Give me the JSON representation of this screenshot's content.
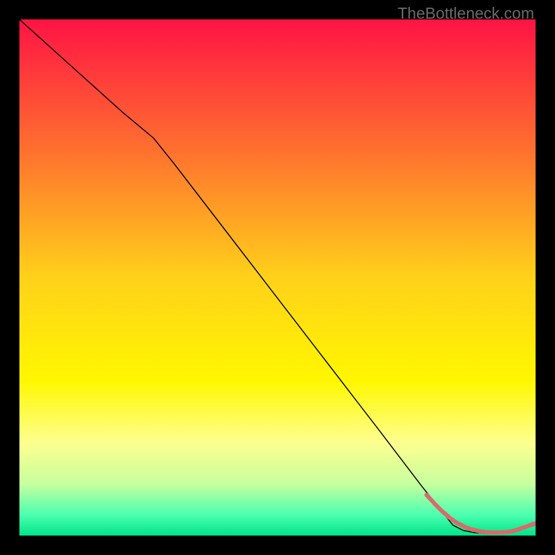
{
  "attribution": "TheBottleneck.com",
  "chart_data": {
    "type": "line",
    "title": "",
    "xlabel": "",
    "ylabel": "",
    "xlim": [
      0,
      100
    ],
    "ylim": [
      0,
      100
    ],
    "grid": false,
    "legend": false,
    "background_gradient": {
      "stops": [
        {
          "offset": 0.0,
          "color": "#ff1344"
        },
        {
          "offset": 0.25,
          "color": "#ff6f2f"
        },
        {
          "offset": 0.5,
          "color": "#ffd11a"
        },
        {
          "offset": 0.7,
          "color": "#fff700"
        },
        {
          "offset": 0.82,
          "color": "#fdff8f"
        },
        {
          "offset": 0.9,
          "color": "#c7ff9e"
        },
        {
          "offset": 0.96,
          "color": "#4bffb0"
        },
        {
          "offset": 1.0,
          "color": "#00e588"
        }
      ]
    },
    "series": [
      {
        "name": "main-curve",
        "type": "line",
        "color": "#000000",
        "width": 1.5,
        "x": [
          0,
          10,
          20,
          26,
          30,
          40,
          50,
          60,
          70,
          78,
          84,
          86,
          88,
          90,
          92,
          94,
          96,
          98,
          99.5
        ],
        "y": [
          100,
          91,
          82,
          77,
          72,
          59,
          46,
          33,
          20,
          9.5,
          2.0,
          1.0,
          0.6,
          0.4,
          0.4,
          0.5,
          0.8,
          1.4,
          2.2
        ]
      },
      {
        "name": "tail-dashes",
        "type": "scatter",
        "marker": "dash",
        "color": "#d86b6b",
        "size": 7,
        "x": [
          79.5,
          81.0,
          82.5,
          84.0,
          85.5,
          87.0,
          88.5,
          90.0,
          91.5,
          93.0,
          94.5,
          96.0,
          97.5,
          99.5
        ],
        "y": [
          7.2,
          5.6,
          4.2,
          3.0,
          2.1,
          1.4,
          1.0,
          0.7,
          0.6,
          0.6,
          0.7,
          1.0,
          1.5,
          2.2
        ]
      }
    ]
  }
}
